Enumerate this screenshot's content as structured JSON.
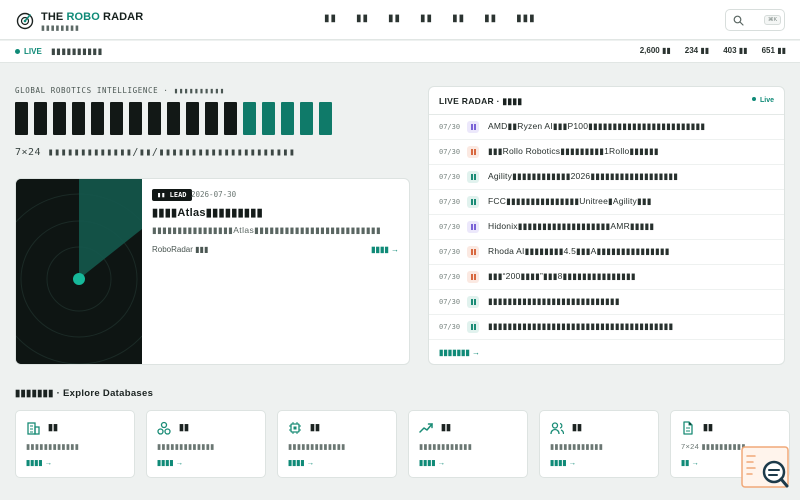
{
  "brand": {
    "title_prefix": "THE ",
    "title_accent": "ROBO",
    "title_suffix": " RADAR",
    "subtitle": "▮▮▮▮▮▮▮▮"
  },
  "nav": {
    "links": [
      "▮▮",
      "▮▮",
      "▮▮",
      "▮▮",
      "▮▮",
      "▮▮",
      "▮▮▮"
    ],
    "search_shortcut": "⌘K"
  },
  "status": {
    "live_label": "LIVE",
    "text": "▮▮▮▮▮▮▮▮▮▮",
    "stats": [
      {
        "value": "2,600",
        "label": "▮▮"
      },
      {
        "value": "234",
        "label": "▮▮"
      },
      {
        "value": "403",
        "label": "▮▮"
      },
      {
        "value": "651",
        "label": "▮▮"
      }
    ]
  },
  "hero": {
    "eyebrow": "GLOBAL ROBOTICS INTELLIGENCE · ▮▮▮▮▮▮▮▮▮▮",
    "subtitle": "7×24 ▮▮▮▮▮▮▮▮▮▮▮▮▮/▮▮/▮▮▮▮▮▮▮▮▮▮▮▮▮▮▮▮▮▮▮▮▮"
  },
  "featured": {
    "badge": "▮▮ LEAD",
    "date": "2026-07-30",
    "title": "▮▮▮▮Atlas▮▮▮▮▮▮▮▮▮",
    "description": "▮▮▮▮▮▮▮▮▮▮▮▮▮▮▮▮Atlas▮▮▮▮▮▮▮▮▮▮▮▮▮▮▮▮▮▮▮▮▮▮▮▮▮",
    "source": "RoboRadar ▮▮▮",
    "more": "▮▮▮▮ →"
  },
  "radar_panel": {
    "title": "LIVE RADAR · ▮▮▮▮",
    "live": "Live",
    "items": [
      {
        "date": "07/30",
        "tag": "purple",
        "text": "AMD▮▮Ryzen AI▮▮▮P100▮▮▮▮▮▮▮▮▮▮▮▮▮▮▮▮▮▮▮▮▮▮▮▮"
      },
      {
        "date": "07/30",
        "tag": "orange",
        "text": "▮▮▮Rollo Robotics▮▮▮▮▮▮▮▮▮1Rollo▮▮▮▮▮▮"
      },
      {
        "date": "07/30",
        "tag": "teal",
        "text": "Agility▮▮▮▮▮▮▮▮▮▮▮▮2026▮▮▮▮▮▮▮▮▮▮▮▮▮▮▮▮▮▮"
      },
      {
        "date": "07/30",
        "tag": "teal",
        "text": "FCC▮▮▮▮▮▮▮▮▮▮▮▮▮▮▮Unitree▮Agility▮▮▮"
      },
      {
        "date": "07/30",
        "tag": "purple",
        "text": "Hidonix▮▮▮▮▮▮▮▮▮▮▮▮▮▮▮▮▮▮▮AMR▮▮▮▮▮"
      },
      {
        "date": "07/30",
        "tag": "orange",
        "text": "Rhoda AI▮▮▮▮▮▮▮▮4.5▮▮▮A▮▮▮▮▮▮▮▮▮▮▮▮▮▮▮"
      },
      {
        "date": "07/30",
        "tag": "orange",
        "text": "▮▮▮“200▮▮▮▮”▮▮▮8▮▮▮▮▮▮▮▮▮▮▮▮▮▮▮"
      },
      {
        "date": "07/30",
        "tag": "teal",
        "text": "▮▮▮▮▮▮▮▮▮▮▮▮▮▮▮▮▮▮▮▮▮▮▮▮▮▮▮"
      },
      {
        "date": "07/30",
        "tag": "teal",
        "text": "▮▮▮▮▮▮▮▮▮▮▮▮▮▮▮▮▮▮▮▮▮▮▮▮▮▮▮▮▮▮▮▮▮▮▮▮▮▮"
      }
    ],
    "more": "▮▮▮▮▮▮▮ →"
  },
  "databases": {
    "title": "▮▮▮▮▮▮▮ · Explore Databases",
    "cards": [
      {
        "icon": "building-icon",
        "name": "▮▮",
        "desc": "▮▮▮▮▮▮▮▮▮▮▮▮",
        "link": "▮▮▮▮ →"
      },
      {
        "icon": "molecule-icon",
        "name": "▮▮",
        "desc": "▮▮▮▮▮▮▮▮▮▮▮▮▮",
        "link": "▮▮▮▮ →"
      },
      {
        "icon": "chip-icon",
        "name": "▮▮",
        "desc": "▮▮▮▮▮▮▮▮▮▮▮▮▮",
        "link": "▮▮▮▮ →"
      },
      {
        "icon": "trend-icon",
        "name": "▮▮",
        "desc": "▮▮▮▮▮▮▮▮▮▮▮▮",
        "link": "▮▮▮▮ →"
      },
      {
        "icon": "users-icon",
        "name": "▮▮",
        "desc": "▮▮▮▮▮▮▮▮▮▮▮▮",
        "link": "▮▮▮▮ →"
      },
      {
        "icon": "document-icon",
        "name": "▮▮",
        "desc": "7×24 ▮▮▮▮▮▮▮▮▮▮",
        "link": "▮▮ →"
      }
    ]
  },
  "colors": {
    "accent": "#0f8a77",
    "ink": "#121816",
    "tag_purple": "#7a62d6",
    "tag_orange": "#d8683f",
    "tag_teal": "#1a8c76"
  }
}
